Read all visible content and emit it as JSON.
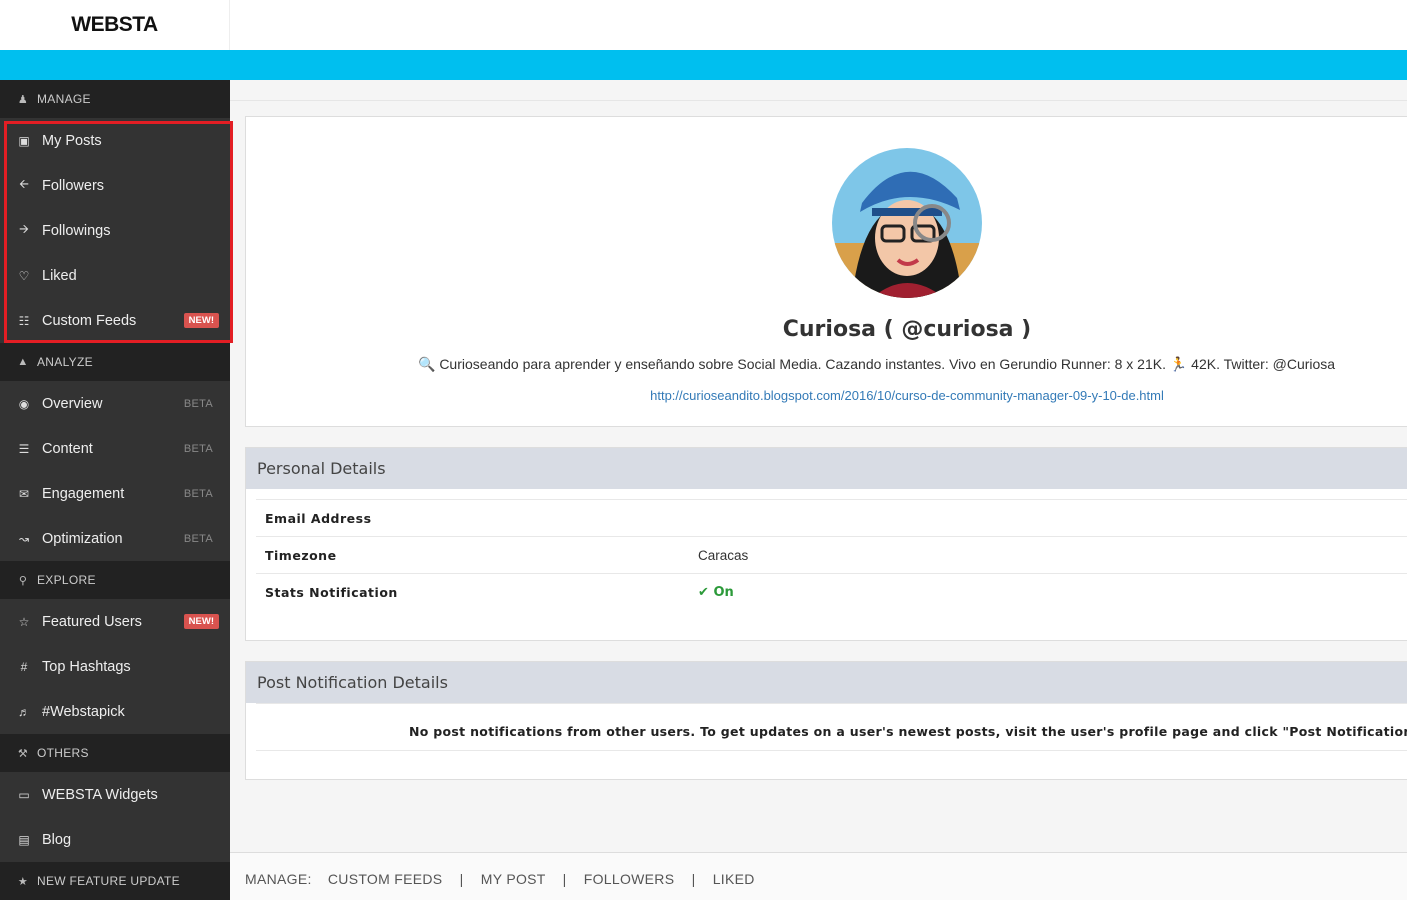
{
  "header": {
    "logo": "WEBSTA"
  },
  "sidebar": {
    "manage": {
      "title": "MANAGE",
      "items": [
        {
          "label": "My Posts"
        },
        {
          "label": "Followers"
        },
        {
          "label": "Followings"
        },
        {
          "label": "Liked"
        },
        {
          "label": "Custom Feeds",
          "badge": "NEW!"
        }
      ]
    },
    "analyze": {
      "title": "ANALYZE",
      "items": [
        {
          "label": "Overview",
          "tag": "BETA"
        },
        {
          "label": "Content",
          "tag": "BETA"
        },
        {
          "label": "Engagement",
          "tag": "BETA"
        },
        {
          "label": "Optimization",
          "tag": "BETA"
        }
      ]
    },
    "explore": {
      "title": "EXPLORE",
      "items": [
        {
          "label": "Featured Users",
          "badge": "NEW!"
        },
        {
          "label": "Top Hashtags"
        },
        {
          "label": "#Webstapick"
        }
      ]
    },
    "others": {
      "title": "OTHERS",
      "items": [
        {
          "label": "WEBSTA Widgets"
        },
        {
          "label": "Blog"
        }
      ]
    },
    "update": {
      "title": "NEW FEATURE UPDATE"
    }
  },
  "profile": {
    "name": "Curiosa ( @curiosa )",
    "bio": "🔍 Curioseando para aprender y enseñando sobre Social Media. Cazando instantes. Vivo en Gerundio Runner: 8 x 21K. 🏃 42K. Twitter: @Curiosa",
    "link": "http://curioseandito.blogspot.com/2016/10/curso-de-community-manager-09-y-10-de.html"
  },
  "personal": {
    "title": "Personal Details",
    "rows": [
      {
        "key": "Email Address",
        "value": ""
      },
      {
        "key": "Timezone",
        "value": "Caracas"
      },
      {
        "key": "Stats Notification",
        "value": "On"
      }
    ]
  },
  "post_notif": {
    "title": "Post Notification Details",
    "message": "No post notifications from other users. To get updates on a user's newest posts, visit the user's profile page and click \"Post Notifications\"."
  },
  "footer": {
    "prefix": "MANAGE:",
    "links": [
      "CUSTOM FEEDS",
      "MY POST",
      "FOLLOWERS",
      "LIKED"
    ]
  },
  "colors": {
    "accent_bar": "#00bfef",
    "sidebar_bg": "#333333",
    "badge_red": "#d9534f",
    "highlight_border": "#e31e24",
    "on_green": "#2c9a3a"
  }
}
